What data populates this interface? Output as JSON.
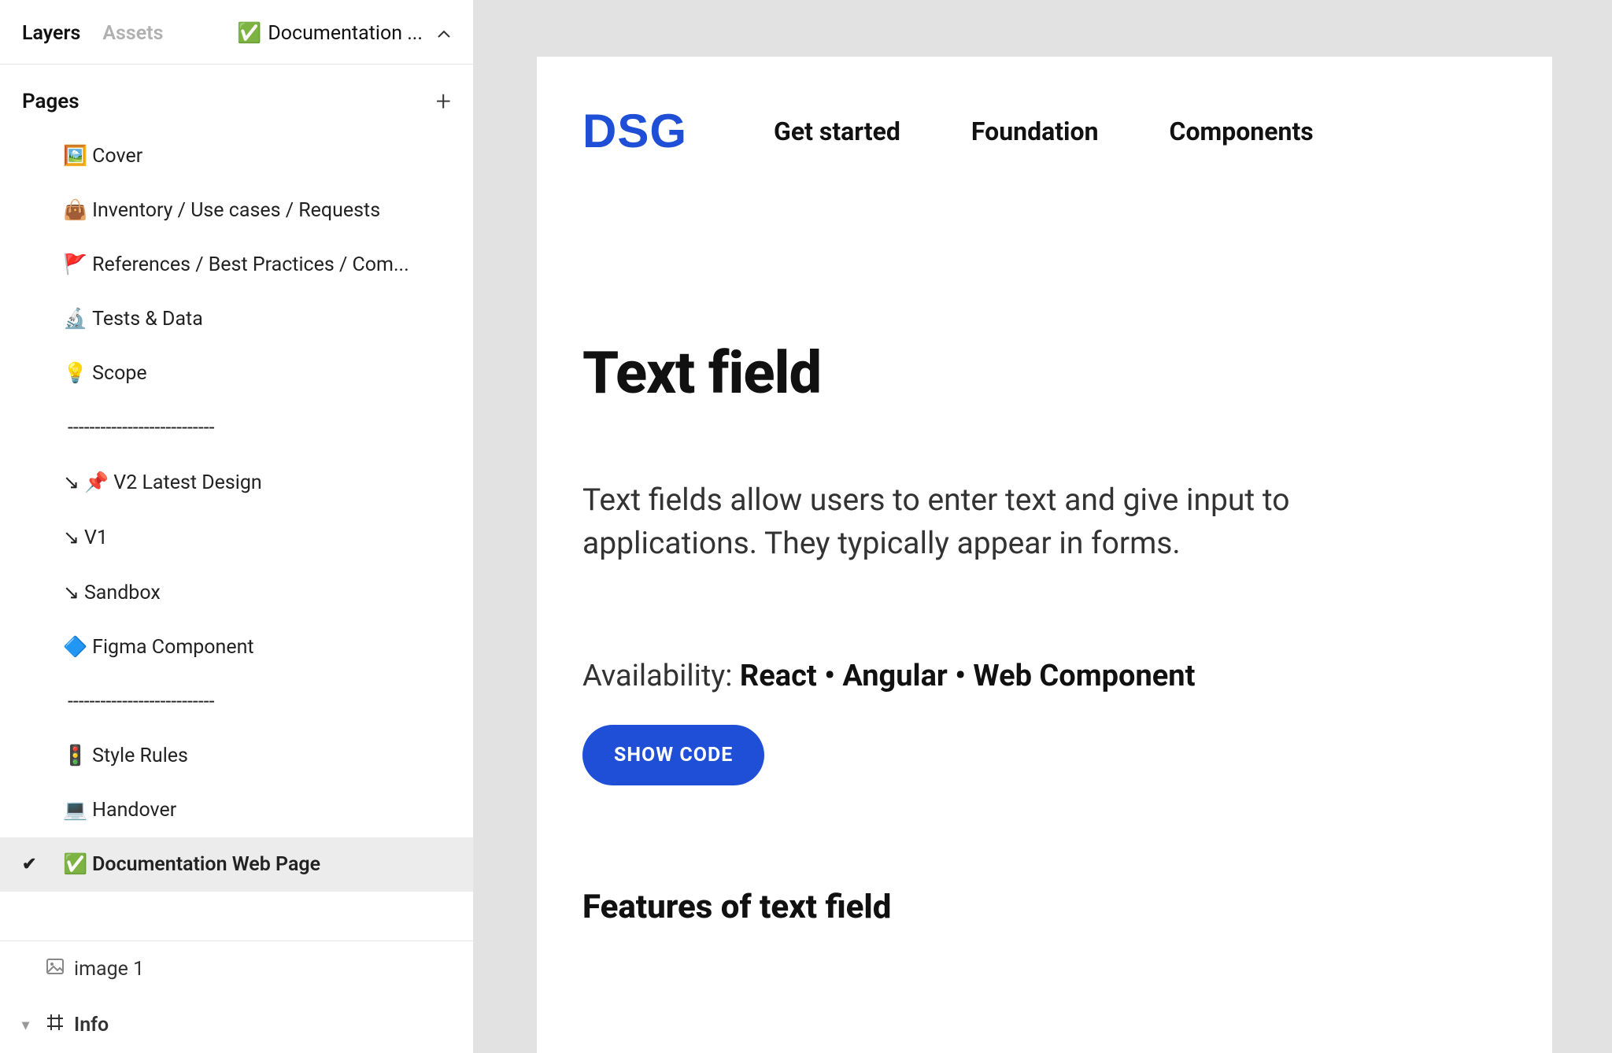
{
  "sidebar": {
    "tabs": {
      "layers": "Layers",
      "assets": "Assets"
    },
    "pageSelector": {
      "icon": "✅",
      "label": "Documentation ..."
    },
    "pagesHeader": "Pages",
    "items": [
      {
        "emoji": "🖼️",
        "label": "Cover"
      },
      {
        "emoji": "👜",
        "label": "Inventory / Use cases / Requests"
      },
      {
        "emoji": "🚩",
        "label": "References  / Best Practices / Com..."
      },
      {
        "emoji": "🔬",
        "label": "Tests & Data"
      },
      {
        "emoji": "💡",
        "label": "Scope"
      },
      {
        "emoji": "",
        "label": "---------------------------"
      },
      {
        "emoji": "↘ 📌",
        "label": "V2  Latest Design"
      },
      {
        "emoji": "↘",
        "label": "V1"
      },
      {
        "emoji": "↘",
        "label": "Sandbox"
      },
      {
        "emoji": "🔷",
        "label": "Figma Component"
      },
      {
        "emoji": "",
        "label": "---------------------------"
      },
      {
        "emoji": "🚦",
        "label": "Style Rules"
      },
      {
        "emoji": "💻",
        "label": "Handover"
      },
      {
        "emoji": "✅",
        "label": "Documentation Web Page",
        "selected": true
      }
    ],
    "frames": [
      {
        "type": "image",
        "label": "image 1"
      },
      {
        "type": "frame",
        "label": "Info",
        "bold": true,
        "caret": true
      }
    ]
  },
  "doc": {
    "logo": "DSG",
    "nav": [
      "Get started",
      "Foundation",
      "Components"
    ],
    "title": "Text field",
    "description": "Text fields allow users to enter text and give input to applications. They typically appear in forms.",
    "availabilityLabel": "Availability: ",
    "availabilityValue": "React • Angular • Web Component",
    "showCode": "SHOW CODE",
    "subhead": "Features of text field"
  }
}
